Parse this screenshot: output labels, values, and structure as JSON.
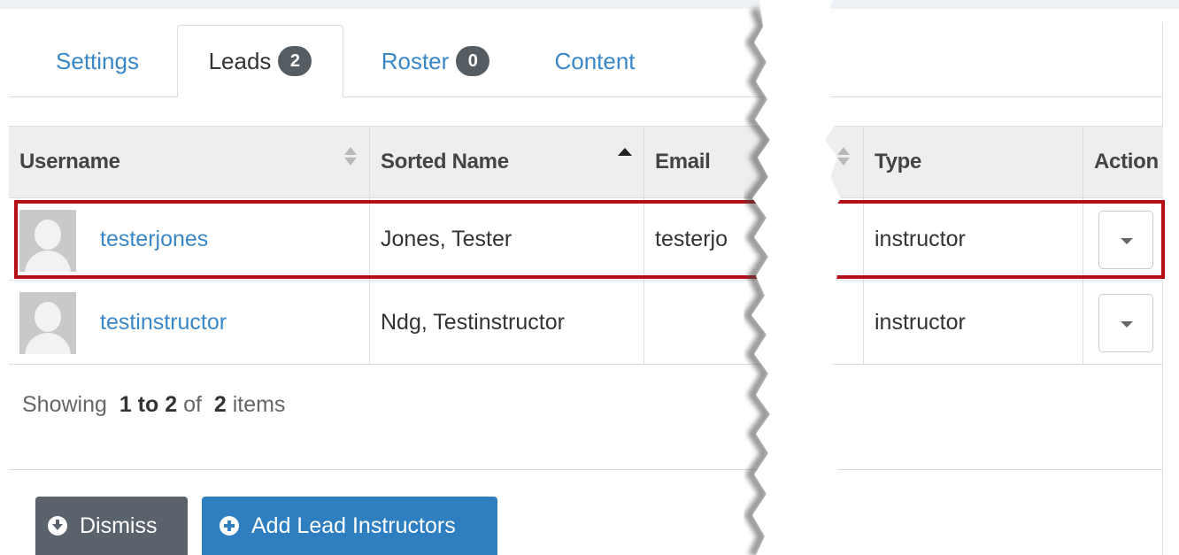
{
  "tabs": [
    {
      "label": "Settings",
      "badge": ""
    },
    {
      "label": "Leads",
      "badge": "2"
    },
    {
      "label": "Roster",
      "badge": "0"
    },
    {
      "label": "Content",
      "badge": ""
    }
  ],
  "active_tab": "Leads",
  "table": {
    "columns": [
      "Username",
      "Sorted Name",
      "Email",
      "Type",
      "Action"
    ],
    "sorted_column": "Sorted Name",
    "rows": [
      {
        "username": "testerjones",
        "sorted_name": "Jones, Tester",
        "email": "testerjo",
        "type": "instructor"
      },
      {
        "username": "testinstructor",
        "sorted_name": "Ndg, Testinstructor",
        "email": "",
        "type": "instructor"
      }
    ]
  },
  "pagination": {
    "prefix": "Showing",
    "range": "1 to 2",
    "of": "of",
    "total": "2",
    "suffix": "items"
  },
  "buttons": {
    "dismiss": "Dismiss",
    "add": "Add Lead Instructors"
  },
  "colors": {
    "link": "#3a87c8",
    "badge": "#555d63",
    "highlight": "#b40e16",
    "dismiss": "#5a636b",
    "add": "#2f7ec0"
  },
  "icons": {
    "dismiss": "circle-arrow-down-icon",
    "add": "circle-plus-icon",
    "action": "caret-down-icon",
    "avatar": "user-silhouette-icon"
  }
}
